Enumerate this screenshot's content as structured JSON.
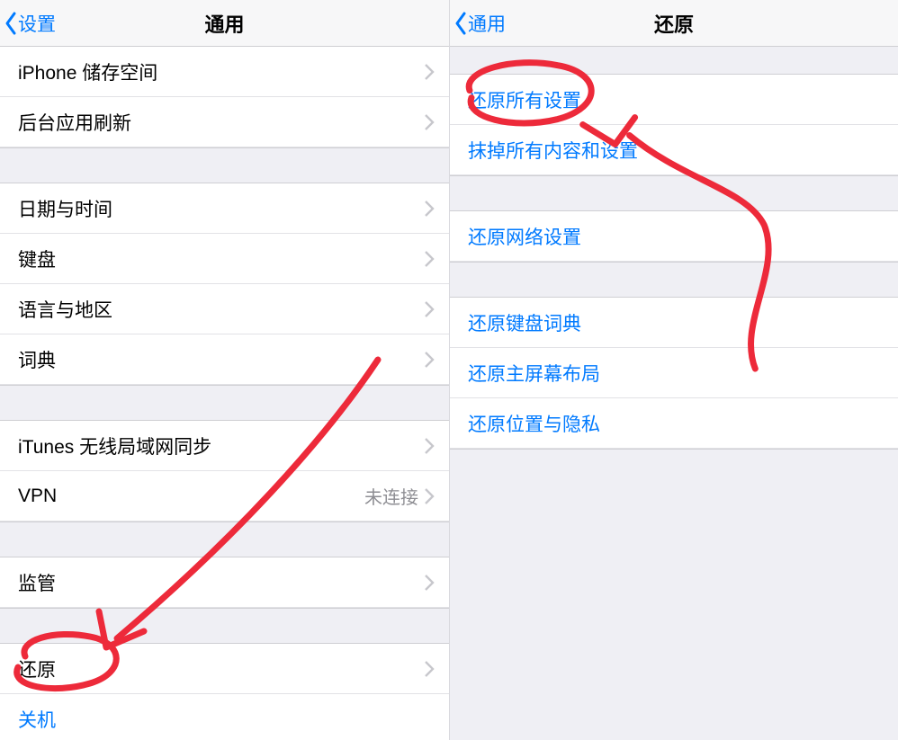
{
  "left": {
    "back_label": "设置",
    "title": "通用",
    "group1": [
      {
        "label": "iPhone 储存空间"
      },
      {
        "label": "后台应用刷新"
      }
    ],
    "group2": [
      {
        "label": "日期与时间"
      },
      {
        "label": "键盘"
      },
      {
        "label": "语言与地区"
      },
      {
        "label": "词典"
      }
    ],
    "group3": [
      {
        "label": "iTunes 无线局域网同步"
      },
      {
        "label": "VPN",
        "value": "未连接"
      }
    ],
    "group4": [
      {
        "label": "监管"
      }
    ],
    "group5": [
      {
        "label": "还原"
      }
    ],
    "shutdown": "关机"
  },
  "right": {
    "back_label": "通用",
    "title": "还原",
    "group1": [
      {
        "label": "还原所有设置"
      },
      {
        "label": "抹掉所有内容和设置"
      }
    ],
    "group2": [
      {
        "label": "还原网络设置"
      }
    ],
    "group3": [
      {
        "label": "还原键盘词典"
      },
      {
        "label": "还原主屏幕布局"
      },
      {
        "label": "还原位置与隐私"
      }
    ]
  }
}
